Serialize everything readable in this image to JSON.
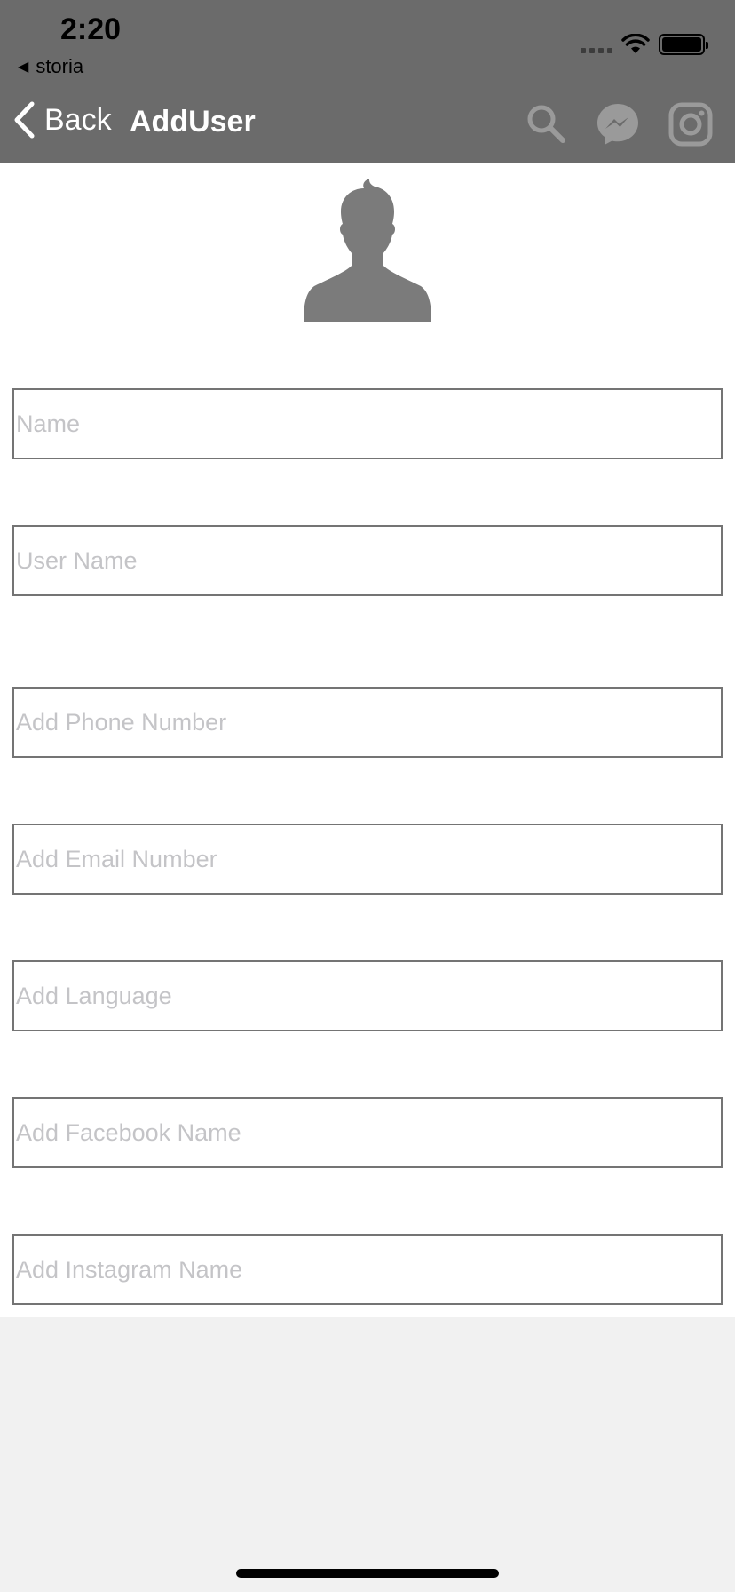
{
  "status_bar": {
    "time": "2:20",
    "back_app": "storia",
    "back_arrow": "◀"
  },
  "nav": {
    "back_label": "Back",
    "title": "AddUser",
    "icons": [
      "search-icon",
      "messenger-icon",
      "instagram-icon"
    ]
  },
  "avatar": {
    "icon": "user-silhouette-icon"
  },
  "form": {
    "name_placeholder": "Name",
    "username_placeholder": "User Name",
    "phone_placeholder": "Add Phone Number",
    "email_placeholder": "Add Email Number",
    "language_placeholder": "Add Language",
    "facebook_placeholder": "Add Facebook Name",
    "instagram_placeholder": "Add Instagram Name"
  },
  "colors": {
    "nav_background": "#6b6b6b",
    "content_background": "#ffffff",
    "page_background": "#f1f1f1",
    "field_border": "#747474",
    "placeholder": "#c4c4c7",
    "icon_gray": "#9a9a9a"
  }
}
